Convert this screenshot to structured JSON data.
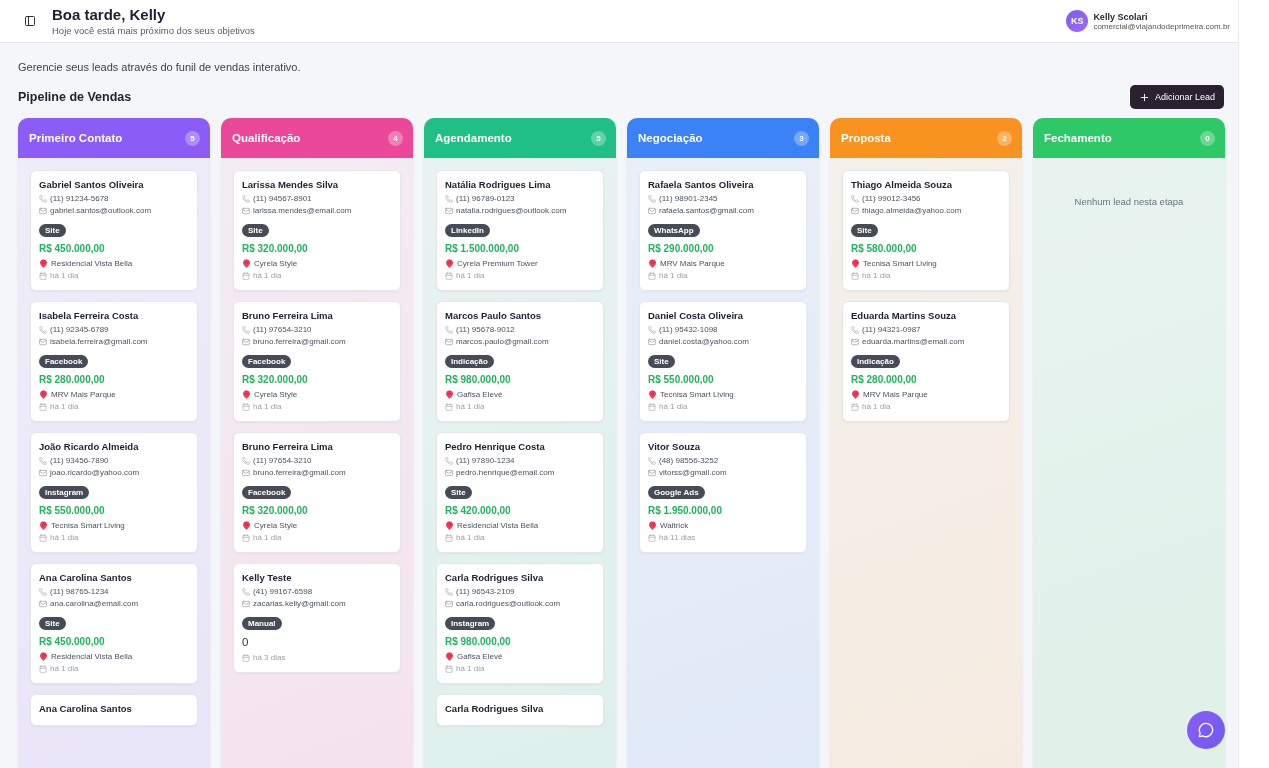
{
  "header": {
    "greeting": "Boa tarde, Kelly",
    "subtitle": "Hoje você está mais próximo dos seus objetivos",
    "user": {
      "initials": "KS",
      "name": "Kelly Scolari",
      "email": "comercial@viajandodeprimeira.com.br"
    }
  },
  "intro": "Gerencie seus leads através do funil de vendas interativo.",
  "pipeline": {
    "title": "Pipeline de Vendas",
    "add_button": "Adicionar Lead",
    "columns": [
      {
        "title": "Primeiro Contato",
        "count": "5",
        "color": "#8b5cf6",
        "cards": [
          {
            "kind": "currency",
            "name": "Gabriel Santos Oliveira",
            "phone": "(11) 91234-5678",
            "email": "gabriel.santos@outlook.com",
            "source": "Site",
            "value": "R$ 450.000,00",
            "project": "Residencial Vista Bella",
            "age": "há 1 dia"
          },
          {
            "kind": "currency",
            "name": "Isabela Ferreira Costa",
            "phone": "(11) 92345-6789",
            "email": "isabela.ferreira@gmail.com",
            "source": "Facebook",
            "value": "R$ 280.000,00",
            "project": "MRV Mais Parque",
            "age": "há 1 dia"
          },
          {
            "kind": "currency",
            "name": "João Ricardo Almeida",
            "phone": "(11) 93456-7890",
            "email": "joao.ricardo@yahoo.com",
            "source": "Instagram",
            "value": "R$ 550.000,00",
            "project": "Tecnisa Smart Living",
            "age": "há 1 dia"
          },
          {
            "kind": "currency",
            "name": "Ana Carolina Santos",
            "phone": "(11) 98765-1234",
            "email": "ana.carolina@email.com",
            "source": "Site",
            "value": "R$ 450.000,00",
            "project": "Residencial Vista Bella",
            "age": "há 1 dia"
          },
          {
            "name": "Ana Carolina Santos"
          }
        ]
      },
      {
        "title": "Qualificação",
        "count": "4",
        "color": "#ec4899",
        "cards": [
          {
            "kind": "currency",
            "name": "Larissa Mendes Silva",
            "phone": "(11) 94567-8901",
            "email": "larissa.mendes@email.com",
            "source": "Site",
            "value": "R$ 320.000,00",
            "project": "Cyrela Style",
            "age": "há 1 dia"
          },
          {
            "kind": "currency",
            "name": "Bruno Ferreira Lima",
            "phone": "(11) 97654-3210",
            "email": "bruno.ferreira@gmail.com",
            "source": "Facebook",
            "value": "R$ 320.000,00",
            "project": "Cyrela Style",
            "age": "há 1 dia"
          },
          {
            "kind": "currency",
            "name": "Bruno Ferreira Lima",
            "phone": "(11) 97654-3210",
            "email": "bruno.ferreira@gmail.com",
            "source": "Facebook",
            "value": "R$ 320.000,00",
            "project": "Cyrela Style",
            "age": "há 1 dia"
          },
          {
            "kind": "plain",
            "name": "Kelly Teste",
            "phone": "(41) 99167-6598",
            "email": "zacarias.kelly@gmail.com",
            "source": "Manual",
            "value": "0",
            "age": "há 3 dias"
          }
        ]
      },
      {
        "title": "Agendamento",
        "count": "5",
        "color": "#1fbf86",
        "cards": [
          {
            "kind": "currency",
            "name": "Natália Rodrigues Lima",
            "phone": "(11) 96789-0123",
            "email": "natalia.rodrigues@outlook.com",
            "source": "LinkedIn",
            "value": "R$ 1.500.000,00",
            "project": "Cyrela Premium Tower",
            "age": "há 1 dia"
          },
          {
            "kind": "currency",
            "name": "Marcos Paulo Santos",
            "phone": "(11) 95678-9012",
            "email": "marcos.paulo@gmail.com",
            "source": "Indicação",
            "value": "R$ 980.000,00",
            "project": "Gafisa Elevé",
            "age": "há 1 dia"
          },
          {
            "kind": "currency",
            "name": "Pedro Henrique Costa",
            "phone": "(11) 97890-1234",
            "email": "pedro.henrique@email.com",
            "source": "Site",
            "value": "R$ 420.000,00",
            "project": "Residencial Vista Bella",
            "age": "há 1 dia"
          },
          {
            "kind": "currency",
            "name": "Carla Rodrigues Silva",
            "phone": "(11) 96543-2109",
            "email": "carla.rodrigues@outlook.com",
            "source": "Instagram",
            "value": "R$ 980.000,00",
            "project": "Gafisa Elevé",
            "age": "há 1 dia"
          },
          {
            "name": "Carla Rodrigues Silva"
          }
        ]
      },
      {
        "title": "Negociação",
        "count": "3",
        "color": "#3b82f6",
        "cards": [
          {
            "kind": "currency",
            "name": "Rafaela Santos Oliveira",
            "phone": "(11) 98901-2345",
            "email": "rafaela.santos@gmail.com",
            "source": "WhatsApp",
            "value": "R$ 290.000,00",
            "project": "MRV Mais Parque",
            "age": "há 1 dia"
          },
          {
            "kind": "currency",
            "name": "Daniel Costa Oliveira",
            "phone": "(11) 95432-1098",
            "email": "daniel.costa@yahoo.com",
            "source": "Site",
            "value": "R$ 550.000,00",
            "project": "Tecnisa Smart Living",
            "age": "há 1 dia"
          },
          {
            "kind": "currency",
            "name": "Vitor Souza",
            "phone": "(48) 98556-3252",
            "email": "vitorss@gmail.com",
            "source": "Google Ads",
            "value": "R$ 1.950.000,00",
            "project": "Waltrick",
            "age": "há 11 dias"
          }
        ]
      },
      {
        "title": "Proposta",
        "count": "2",
        "color": "#f7931e",
        "cards": [
          {
            "kind": "currency",
            "name": "Thiago Almeida Souza",
            "phone": "(11) 99012-3456",
            "email": "thiago.almeida@yahoo.com",
            "source": "Site",
            "value": "R$ 580.000,00",
            "project": "Tecnisa Smart Living",
            "age": "há 1 dia"
          },
          {
            "kind": "currency",
            "name": "Eduarda Martins Souza",
            "phone": "(11) 94321-0987",
            "email": "eduarda.martins@email.com",
            "source": "Indicação",
            "value": "R$ 280.000,00",
            "project": "MRV Mais Parque",
            "age": "há 1 dia"
          }
        ]
      },
      {
        "title": "Fechamento",
        "count": "0",
        "color": "#2ec866",
        "empty_text": "Nenhum lead nesta etapa"
      }
    ]
  }
}
